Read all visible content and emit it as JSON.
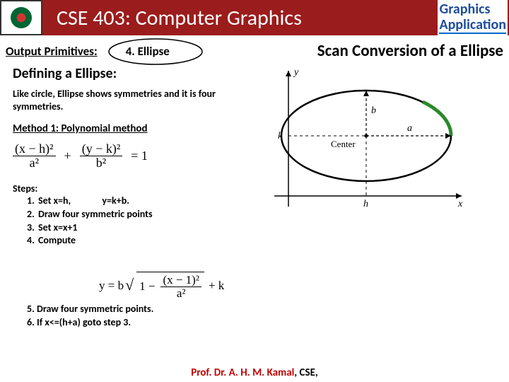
{
  "header": {
    "title": "CSE 403: Computer Graphics",
    "tag_line1": "Graphics",
    "tag_line2": "Application"
  },
  "subhead": {
    "output_primitives": "Output Primitives:",
    "ellipse_num": "4. Ellipse",
    "scan": "Scan Conversion of a Ellipse"
  },
  "body": {
    "defining": "Defining a Ellipse:",
    "desc": "Like circle, Ellipse shows symmetries and it is four symmetries.",
    "method": "Method 1: Polynomial method",
    "eq1": {
      "num1": "(x − h)²",
      "den1": "a²",
      "plus": "+",
      "num2": "(y − k)²",
      "den2": "b²",
      "eq": "= 1"
    },
    "steps_label": "Steps:",
    "steps": [
      "Set x=h,              y=k+b.",
      "Draw four symmetric points",
      "Set x=x+1",
      "Compute"
    ],
    "eq2": {
      "lhs": "y = b",
      "one": "1 −",
      "num": "(x − 1)²",
      "den": "a²",
      "tail": "+ k"
    },
    "later_steps": [
      "Draw four symmetric points.",
      "If x<=(h+a) goto step 3."
    ]
  },
  "diagram": {
    "y": "y",
    "x": "x",
    "a": "a",
    "b": "b",
    "h": "h",
    "k": "k",
    "center": "Center"
  },
  "footer": {
    "prof": "Prof. Dr. A. H. M. Kamal",
    "rest": ", CSE,"
  }
}
